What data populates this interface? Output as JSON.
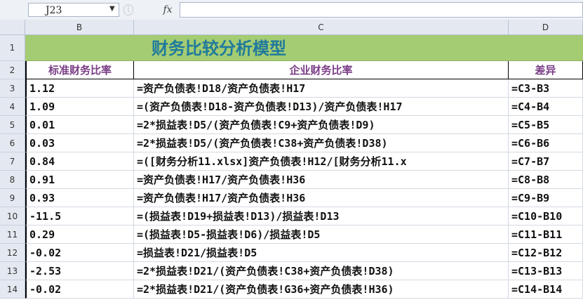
{
  "formula_bar": {
    "cell_ref": "J23",
    "fx_label": "fx",
    "formula": ""
  },
  "columns": [
    {
      "key": "B",
      "label": "B"
    },
    {
      "key": "C",
      "label": "C"
    },
    {
      "key": "D",
      "label": "D"
    }
  ],
  "title": "财务比较分析模型",
  "header": {
    "b": "标准财务比率",
    "c": "企业财务比率",
    "d": "差异"
  },
  "rows": [
    {
      "num": "1"
    },
    {
      "num": "2"
    },
    {
      "num": "3",
      "b": "1.12",
      "c": "=资产负债表!D18/资产负债表!H17",
      "d": "=C3-B3"
    },
    {
      "num": "4",
      "b": "1.09",
      "c": "=(资产负债表!D18-资产负债表!D13)/资产负债表!H17",
      "d": "=C4-B4"
    },
    {
      "num": "5",
      "b": "0.01",
      "c": "=2*损益表!D5/(资产负债表!C9+资产负债表!D9)",
      "d": "=C5-B5"
    },
    {
      "num": "6",
      "b": "0.03",
      "c": "=2*损益表!D5/(资产负债表!C38+资产负债表!D38)",
      "d": "=C6-B6"
    },
    {
      "num": "7",
      "b": "0.84",
      "c": "=([财务分析11.xlsx]资产负债表!H12/[财务分析11.x",
      "d": "=C7-B7"
    },
    {
      "num": "8",
      "b": "0.91",
      "c": "=资产负债表!H17/资产负债表!H36",
      "d": "=C8-B8"
    },
    {
      "num": "9",
      "b": "0.93",
      "c": "=资产负债表!H17/资产负债表!H36",
      "d": "=C9-B9"
    },
    {
      "num": "10",
      "b": "-11.5",
      "c": "=(损益表!D19+损益表!D13)/损益表!D13",
      "d": "=C10-B10"
    },
    {
      "num": "11",
      "b": "0.29",
      "c": "=(损益表!D5-损益表!D6)/损益表!D5",
      "d": "=C11-B11"
    },
    {
      "num": "12",
      "b": "-0.02",
      "c": "=损益表!D21/损益表!D5",
      "d": "=C12-B12"
    },
    {
      "num": "13",
      "b": "-2.53",
      "c": "=2*损益表!D21/(资产负债表!C38+资产负债表!D38)",
      "d": "=C13-B13"
    },
    {
      "num": "14",
      "b": "-0.02",
      "c": "=2*损益表!D21/(资产负债表!G36+资产负债表!H36)",
      "d": "=C14-B14"
    }
  ]
}
